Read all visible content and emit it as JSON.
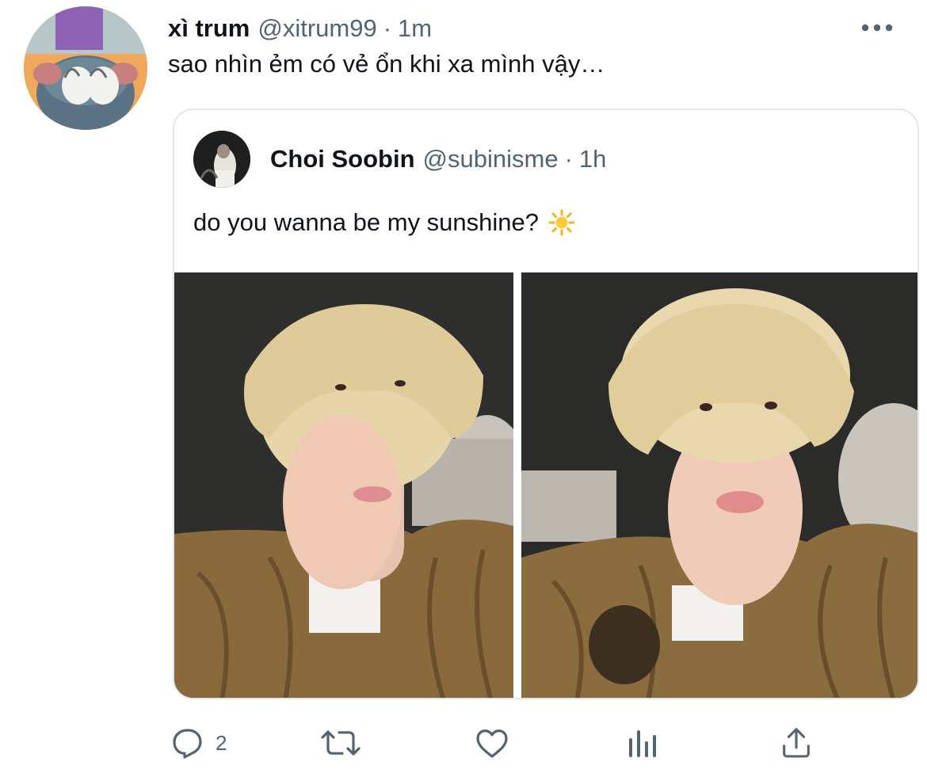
{
  "tweet": {
    "display_name": "xì trum",
    "handle": "@xitrum99",
    "separator": "·",
    "time": "1m",
    "text": "sao nhìn ẻm có vẻ ổn khi xa mình vậy…",
    "reply_count": "2"
  },
  "quoted_tweet": {
    "display_name": "Choi Soobin",
    "handle": "@subinisme",
    "separator": "·",
    "time": "1h",
    "text": "do you wanna be my sunshine?"
  },
  "icons": {
    "more": "more-horizontal-icon",
    "reply": "reply-icon",
    "retweet": "retweet-icon",
    "like": "heart-icon",
    "analytics": "analytics-icon",
    "share": "share-icon",
    "emoji": "sun-icon"
  },
  "colors": {
    "text": "#0f1419",
    "secondary": "#536471",
    "border": "#e1e8ed"
  }
}
